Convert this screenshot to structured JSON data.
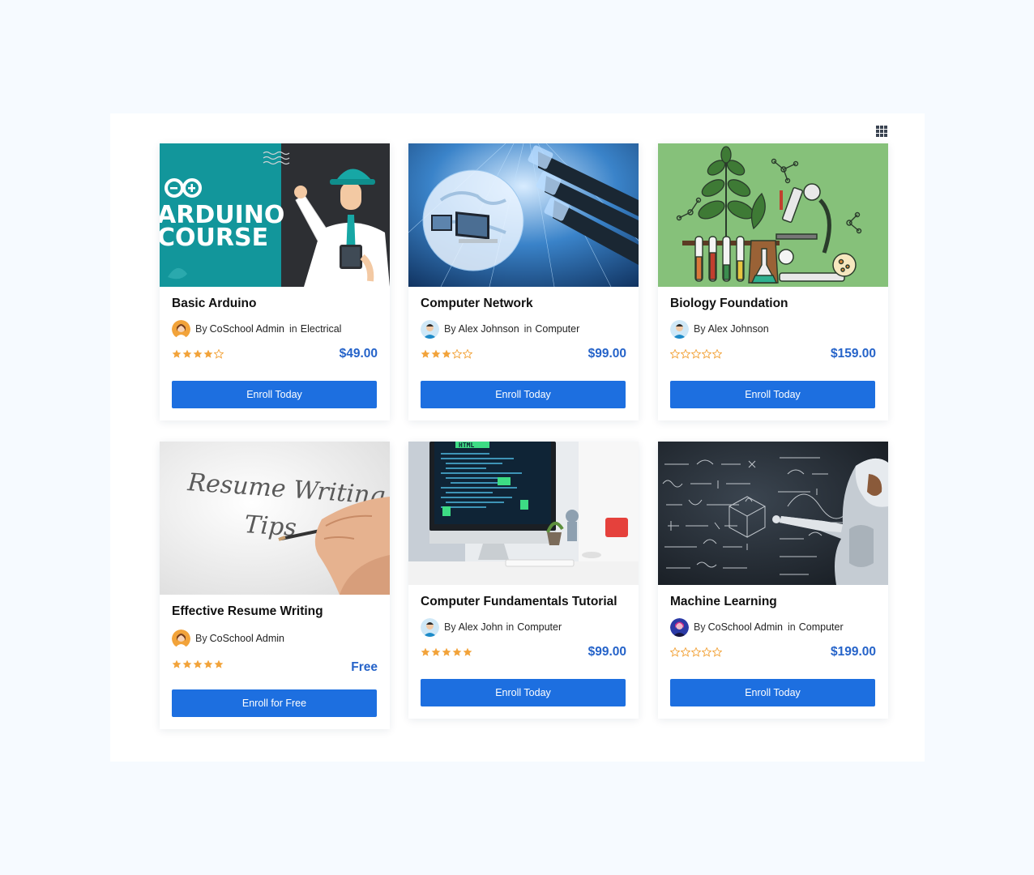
{
  "colors": {
    "accent": "#1d6fe0",
    "price": "#2563c9",
    "star": "#f2a33a",
    "page_bg": "#f6faff"
  },
  "view_toggle_icon": "grid-view-icon",
  "courses": [
    {
      "title": "Basic Arduino",
      "by": "By",
      "author": "CoSchool Admin",
      "in": "in",
      "category": "Electrical",
      "rating": 4,
      "price": "$49.00",
      "button": "Enroll Today",
      "image_text": [
        "ARDUINO",
        "COURSE"
      ]
    },
    {
      "title": "Computer Network",
      "by": "By",
      "author": "Alex Johnson",
      "in": "in",
      "category": "Computer",
      "rating": 3,
      "price": "$99.00",
      "button": "Enroll Today"
    },
    {
      "title": "Biology Foundation",
      "by": "By",
      "author": "Alex Johnson",
      "in": "",
      "category": "",
      "rating": 0,
      "price": "$159.00",
      "button": "Enroll Today"
    },
    {
      "title": "Effective Resume Writing",
      "by": "By",
      "author": "CoSchool Admin",
      "in": "",
      "category": "",
      "rating": 5,
      "price": "Free",
      "button": "Enroll for Free",
      "image_text": [
        "Resume Writing",
        "Tips"
      ]
    },
    {
      "title": "Computer Fundamentals Tutorial",
      "by": "By",
      "author": "Alex John",
      "in": "in",
      "category": "Computer",
      "rating": 5,
      "price": "$99.00",
      "button": "Enroll Today",
      "image_text": [
        "HTML"
      ]
    },
    {
      "title": "Machine Learning",
      "by": "By",
      "author": "CoSchool Admin",
      "in": "in",
      "category": "Computer",
      "rating": 0,
      "price": "$199.00",
      "button": "Enroll Today"
    }
  ]
}
